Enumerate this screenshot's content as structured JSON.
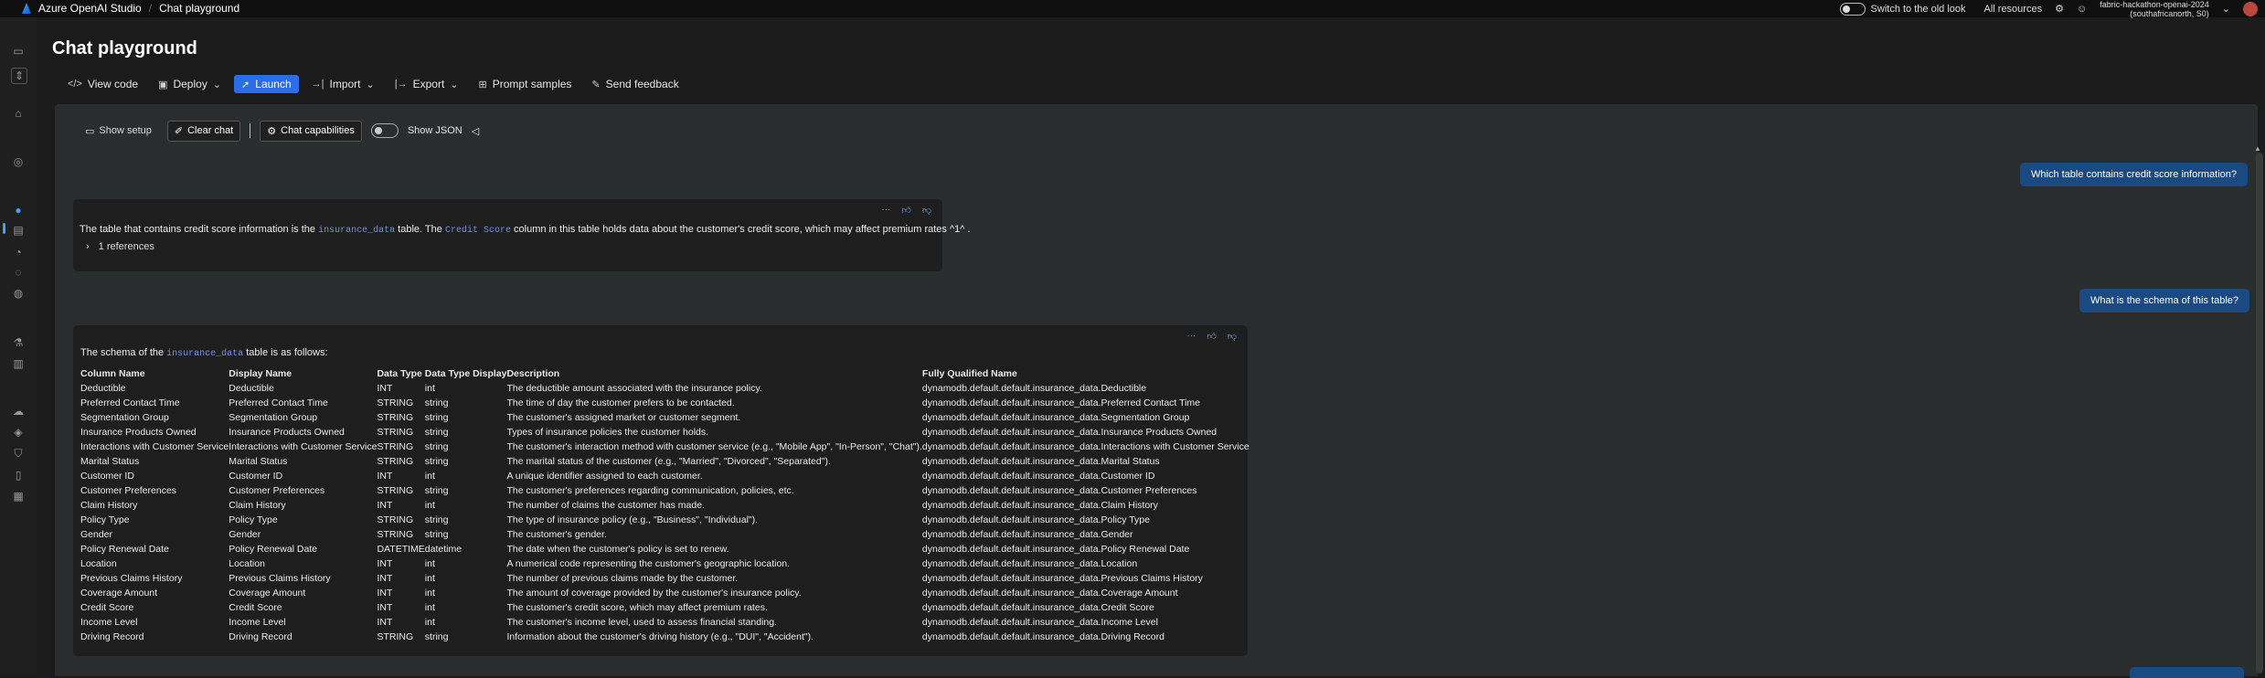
{
  "topbar": {
    "app_name": "Azure OpenAI Studio",
    "separator": "/",
    "page_crumb": "Chat playground",
    "switch_label": "Switch to the old look",
    "all_resources": "All resources",
    "resource_name": "fabric-hackathon-openai-2024",
    "resource_region": "(southafricanorth, S0)"
  },
  "page": {
    "title": "Chat playground"
  },
  "toolbar": {
    "view_code": "View code",
    "deploy": "Deploy",
    "launch": "Launch",
    "import": "Import",
    "export": "Export",
    "prompt_samples": "Prompt samples",
    "send_feedback": "Send feedback"
  },
  "panel_toolbar": {
    "show_setup": "Show setup",
    "clear_chat": "Clear chat",
    "chat_capabilities": "Chat capabilities",
    "show_json": "Show JSON"
  },
  "messages": {
    "user1": "Which table contains credit score information?",
    "assistant1": {
      "pre": "The table that contains credit score information is the ",
      "table": "insurance_data",
      "mid": " table. The ",
      "column": "Credit Score",
      "post": " column in this table holds data about the customer's credit score, which may affect premium rates ^1^ .",
      "references": "1 references"
    },
    "user2": "What is the schema of this table?",
    "assistant2": {
      "pre": "The schema of the ",
      "table": "insurance_data",
      "post": " table is as follows:"
    }
  },
  "schema_table": {
    "headers": [
      "Column Name",
      "Display Name",
      "Data Type",
      "Data Type Display",
      "Description",
      "Fully Qualified Name"
    ],
    "rows": [
      [
        "Deductible",
        "Deductible",
        "INT",
        "int",
        "The deductible amount associated with the insurance policy.",
        "dynamodb.default.default.insurance_data.Deductible"
      ],
      [
        "Preferred Contact Time",
        "Preferred Contact Time",
        "STRING",
        "string",
        "The time of day the customer prefers to be contacted.",
        "dynamodb.default.default.insurance_data.Preferred Contact Time"
      ],
      [
        "Segmentation Group",
        "Segmentation Group",
        "STRING",
        "string",
        "The customer's assigned market or customer segment.",
        "dynamodb.default.default.insurance_data.Segmentation Group"
      ],
      [
        "Insurance Products Owned",
        "Insurance Products Owned",
        "STRING",
        "string",
        "Types of insurance policies the customer holds.",
        "dynamodb.default.default.insurance_data.Insurance Products Owned"
      ],
      [
        "Interactions with Customer Service",
        "Interactions with Customer Service",
        "STRING",
        "string",
        "The customer's interaction method with customer service (e.g., \"Mobile App\", \"In-Person\", \"Chat\").",
        "dynamodb.default.default.insurance_data.Interactions with Customer Service"
      ],
      [
        "Marital Status",
        "Marital Status",
        "STRING",
        "string",
        "The marital status of the customer (e.g., \"Married\", \"Divorced\", \"Separated\").",
        "dynamodb.default.default.insurance_data.Marital Status"
      ],
      [
        "Customer ID",
        "Customer ID",
        "INT",
        "int",
        "A unique identifier assigned to each customer.",
        "dynamodb.default.default.insurance_data.Customer ID"
      ],
      [
        "Customer Preferences",
        "Customer Preferences",
        "STRING",
        "string",
        "The customer's preferences regarding communication, policies, etc.",
        "dynamodb.default.default.insurance_data.Customer Preferences"
      ],
      [
        "Claim History",
        "Claim History",
        "INT",
        "int",
        "The number of claims the customer has made.",
        "dynamodb.default.default.insurance_data.Claim History"
      ],
      [
        "Policy Type",
        "Policy Type",
        "STRING",
        "string",
        "The type of insurance policy (e.g., \"Business\", \"Individual\").",
        "dynamodb.default.default.insurance_data.Policy Type"
      ],
      [
        "Gender",
        "Gender",
        "STRING",
        "string",
        "The customer's gender.",
        "dynamodb.default.default.insurance_data.Gender"
      ],
      [
        "Policy Renewal Date",
        "Policy Renewal Date",
        "DATETIME",
        "datetime",
        "The date when the customer's policy is set to renew.",
        "dynamodb.default.default.insurance_data.Policy Renewal Date"
      ],
      [
        "Location",
        "Location",
        "INT",
        "int",
        "A numerical code representing the customer's geographic location.",
        "dynamodb.default.default.insurance_data.Location"
      ],
      [
        "Previous Claims History",
        "Previous Claims History",
        "INT",
        "int",
        "The number of previous claims made by the customer.",
        "dynamodb.default.default.insurance_data.Previous Claims History"
      ],
      [
        "Coverage Amount",
        "Coverage Amount",
        "INT",
        "int",
        "The amount of coverage provided by the customer's insurance policy.",
        "dynamodb.default.default.insurance_data.Coverage Amount"
      ],
      [
        "Credit Score",
        "Credit Score",
        "INT",
        "int",
        "The customer's credit score, which may affect premium rates.",
        "dynamodb.default.default.insurance_data.Credit Score"
      ],
      [
        "Income Level",
        "Income Level",
        "INT",
        "int",
        "The customer's income level, used to assess financial standing.",
        "dynamodb.default.default.insurance_data.Income Level"
      ],
      [
        "Driving Record",
        "Driving Record",
        "STRING",
        "string",
        "Information about the customer's driving history (e.g., \"DUI\", \"Accident\").",
        "dynamodb.default.default.insurance_data.Driving Record"
      ]
    ]
  }
}
